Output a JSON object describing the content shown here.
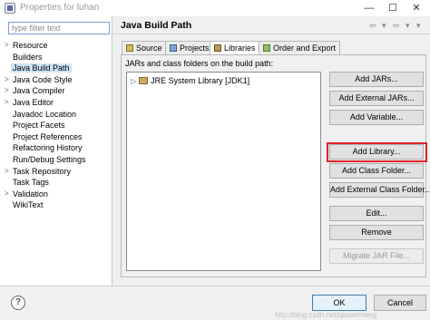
{
  "window": {
    "title": "Properties for luhan",
    "controls": {
      "minimize": "—",
      "maximize": "☐",
      "close": "✕"
    }
  },
  "filter": {
    "placeholder": "type filter text",
    "value": ""
  },
  "tree": {
    "items": [
      {
        "label": "Resource",
        "expandable": true,
        "selected": false
      },
      {
        "label": "Builders",
        "expandable": false,
        "selected": false
      },
      {
        "label": "Java Build Path",
        "expandable": false,
        "selected": true
      },
      {
        "label": "Java Code Style",
        "expandable": true,
        "selected": false
      },
      {
        "label": "Java Compiler",
        "expandable": true,
        "selected": false
      },
      {
        "label": "Java Editor",
        "expandable": true,
        "selected": false
      },
      {
        "label": "Javadoc Location",
        "expandable": false,
        "selected": false
      },
      {
        "label": "Project Facets",
        "expandable": false,
        "selected": false
      },
      {
        "label": "Project References",
        "expandable": false,
        "selected": false
      },
      {
        "label": "Refactoring History",
        "expandable": false,
        "selected": false
      },
      {
        "label": "Run/Debug Settings",
        "expandable": false,
        "selected": false
      },
      {
        "label": "Task Repository",
        "expandable": true,
        "selected": false
      },
      {
        "label": "Task Tags",
        "expandable": false,
        "selected": false
      },
      {
        "label": "Validation",
        "expandable": true,
        "selected": false
      },
      {
        "label": "WikiText",
        "expandable": false,
        "selected": false
      }
    ]
  },
  "page": {
    "title": "Java Build Path",
    "nav": {
      "back": "⇦",
      "forward": "⇨",
      "menu": "▾"
    }
  },
  "tabs": [
    {
      "label": "Source",
      "active": false
    },
    {
      "label": "Projects",
      "active": false
    },
    {
      "label": "Libraries",
      "active": true
    },
    {
      "label": "Order and Export",
      "active": false
    }
  ],
  "libraries": {
    "heading": "JARs and class folders on the build path:",
    "entries": [
      {
        "label": "JRE System Library [JDK1]"
      }
    ]
  },
  "buttons": {
    "add_jars": "Add JARs...",
    "add_external_jars": "Add External JARs...",
    "add_variable": "Add Variable...",
    "add_library": "Add Library...",
    "add_class_folder": "Add Class Folder...",
    "add_external_class_folder": "Add External Class Folder...",
    "edit": "Edit...",
    "remove": "Remove",
    "migrate_jar": "Migrate JAR File..."
  },
  "footer": {
    "help": "?",
    "ok": "OK",
    "cancel": "Cancel",
    "watermark": "http://blog.csdn.net/qiaoermeng"
  },
  "colors": {
    "highlight": "#e0202a",
    "selection": "#cce4f7",
    "accent": "#3c7fb1"
  }
}
